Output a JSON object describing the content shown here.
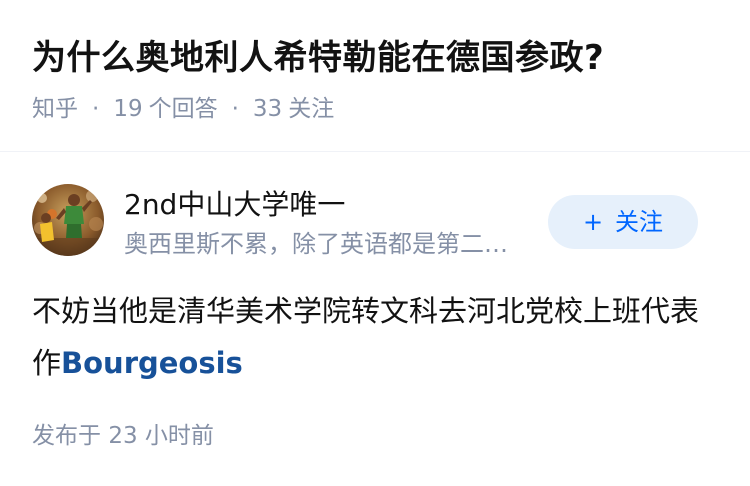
{
  "question": {
    "title": "为什么奥地利人希特勒能在德国参政?",
    "source": "知乎",
    "answers_count": "19",
    "answers_label": "个回答",
    "follows_count": "33",
    "follows_label": "关注"
  },
  "answer": {
    "author_name": "2nd中山大学唯一",
    "author_bio": "奥西里斯不累，除了英语都是第二…",
    "follow_button_icon": "plus-icon",
    "follow_button_plus": "+",
    "follow_button_label": "关注",
    "content_text": "不妨当他是清华美术学院转文科去河北党校上班代表作",
    "content_link": "Bourgeosis",
    "time_label": "发布于",
    "time_value": "23 小时前"
  },
  "colors": {
    "primary_text": "#121212",
    "meta_text": "#8590a6",
    "follow_bg": "#e6f0fb",
    "follow_text": "#0066ff",
    "link": "#175199"
  }
}
